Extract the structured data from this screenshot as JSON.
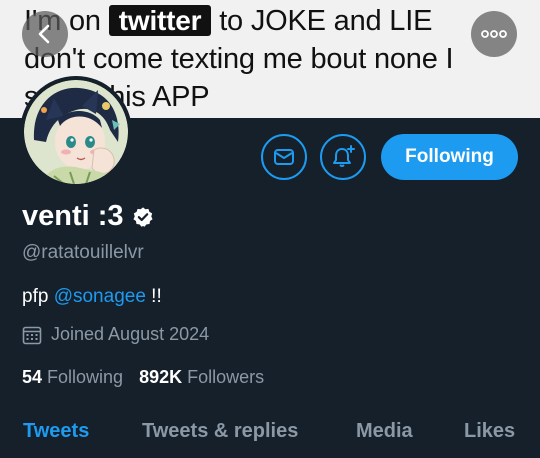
{
  "banner": {
    "line1_before": "I'm on ",
    "line1_highlight": "twitter",
    "line1_after": " to JOKE and LIE",
    "line2": "don't come texting me bout none I",
    "line3": "s     n this APP"
  },
  "profile": {
    "display_name": "venti :3",
    "handle": "@ratatouillelvr",
    "bio_prefix": "pfp ",
    "bio_mention": "@sonagee",
    "bio_suffix": " !!",
    "joined": "Joined August 2024",
    "following_count": "54",
    "following_label": "Following",
    "followers_count": "892K",
    "followers_label": "Followers"
  },
  "actions": {
    "follow_label": "Following",
    "message_icon": "envelope-icon",
    "notify_icon": "bell-plus-icon"
  },
  "tabs": [
    {
      "label": "Tweets",
      "active": true
    },
    {
      "label": "Tweets & replies",
      "active": false
    },
    {
      "label": "Media",
      "active": false
    },
    {
      "label": "Likes",
      "active": false
    }
  ],
  "colors": {
    "background": "#15202b",
    "accent": "#1d9bf0",
    "secondary_text": "#8b98a5"
  }
}
